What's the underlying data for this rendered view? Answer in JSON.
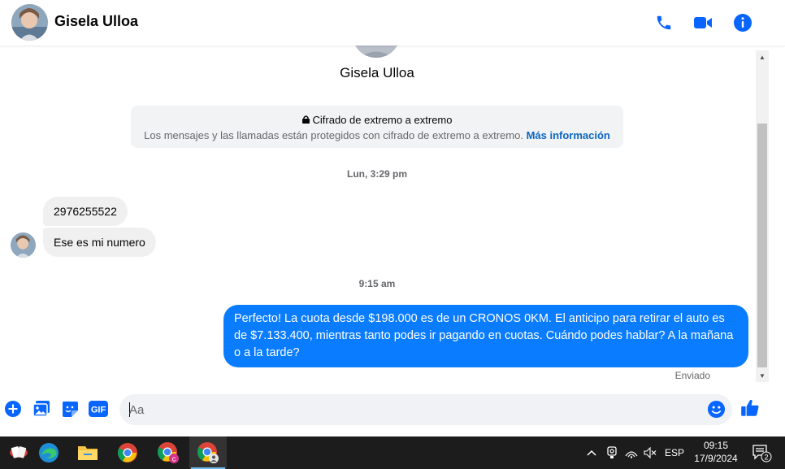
{
  "header": {
    "name": "Gisela Ulloa",
    "icons": [
      "phone-icon",
      "video-camera-icon",
      "info-icon"
    ]
  },
  "conversation": {
    "contact_name": "Gisela Ulloa",
    "encryption": {
      "title": "Cifrado de extremo a extremo",
      "subtitle": "Los mensajes y las llamadas están protegidos con cifrado de extremo a extremo.",
      "link": "Más información"
    },
    "timestamp_1": "Lun, 3:29 pm",
    "incoming": [
      "2976255522",
      "Ese es mi numero"
    ],
    "timestamp_2": "9:15 am",
    "outgoing": "Perfecto! La cuota desde $198.000 es de un CRONOS 0KM. El anticipo para retirar el auto es de $7.133.400, mientras tanto podes ir pagando en cuotas. Cuándo podes hablar? A la mañana o a la tarde?",
    "status": "Enviado"
  },
  "composer": {
    "placeholder": "Aa",
    "icons": [
      "plus-icon",
      "image-icon",
      "sticker-icon",
      "gif-icon",
      "emoji-icon",
      "like-icon"
    ],
    "gif_label": "GIF"
  },
  "taskbar": {
    "apps": [
      "card-game-icon",
      "edge-icon",
      "file-explorer-icon",
      "chrome-icon",
      "chrome-profile-icon",
      "chrome-active-icon"
    ],
    "language": "ESP",
    "time": "09:15",
    "date": "17/9/2024",
    "notification_count": "2"
  },
  "colors": {
    "accent": "#0a7cff",
    "link": "#0a66c2",
    "icon_blue": "#0866ff"
  }
}
